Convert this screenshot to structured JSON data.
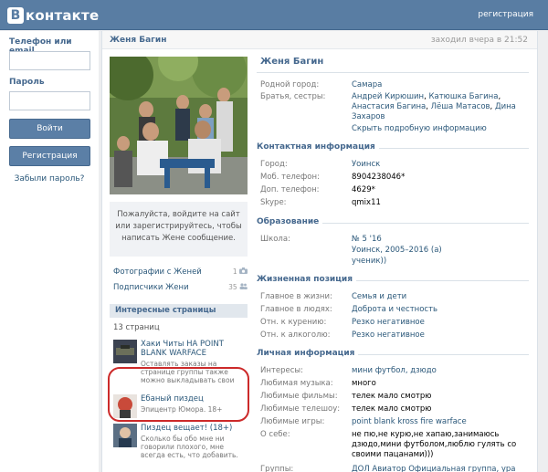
{
  "header": {
    "logo_mark": "В",
    "logo_text": "контакте",
    "register_link": "регистрация"
  },
  "login": {
    "phone_label": "Телефон или email",
    "password_label": "Пароль",
    "login_button": "Войти",
    "register_button": "Регистрация",
    "forgot_link": "Забыли пароль?"
  },
  "profile": {
    "head_name": "Женя Багин",
    "status": "заходил вчера в 21:52",
    "name": "Женя Багин",
    "message_prompt": "Пожалуйста, войдите на сайт или зарегистрируйтесь, чтобы написать Жене сообщение.",
    "photos_link": "Фотографии с Женей",
    "photos_count": "1",
    "subscribers_link": "Подписчики Жени",
    "subscribers_count": "35",
    "interesting_title": "Интересные страницы",
    "pages_count": "13 страниц",
    "pages": [
      {
        "title": "Хаки Читы НА POINT BLANK WARFACE",
        "desc": "Оставлять заказы на странице группы также можно выкладывать свои"
      },
      {
        "title": "Ебаный пиздец",
        "desc": "Эпицентр Юмора. 18+"
      },
      {
        "title": "Пиздец вещает! (18+)",
        "desc": "Сколько бы обо мне ни говорили плохого, мне всегда есть, что добавить."
      }
    ]
  },
  "info": {
    "hometown_label": "Родной город:",
    "hometown": "Самара",
    "siblings_label": "Братья, сестры:",
    "siblings": [
      "Андрей Кирюшин",
      "Катюшка Багина",
      "Анастасия Багина",
      "Лёша Матасов",
      "Дина Захаров"
    ],
    "show_more": "Скрыть подробную информацию",
    "contact_title": "Контактная информация",
    "city_label": "Город:",
    "city": "Уоинск",
    "mobile_label": "Моб. телефон:",
    "mobile": "8904238046*",
    "extra_phone_label": "Доп. телефон:",
    "extra_phone": "4629*",
    "skype_label": "Skype:",
    "skype": "qmix11",
    "education_title": "Образование",
    "school_label": "Школа:",
    "school": "№ 5 '16",
    "school_detail": "Уоинск, 2005–2016 (а)",
    "school_role": "ученик))",
    "position_title": "Жизненная позиция",
    "main_label": "Главное в жизни:",
    "main": "Семья и дети",
    "people_label": "Главное в людях:",
    "people": "Доброта и честность",
    "smoking_label": "Отн. к курению:",
    "smoking": "Резко негативное",
    "alcohol_label": "Отн. к алкоголю:",
    "alcohol": "Резко негативное",
    "personal_title": "Личная информация",
    "interests_label": "Интересы:",
    "interests": "мини футбол, дзюдо",
    "music_label": "Любимая музыка:",
    "music": "много",
    "films_label": "Любимые фильмы:",
    "films": "телек мало смотрю",
    "tv_label": "Любимые телешоу:",
    "tv": "телек мало смотрю",
    "games_label": "Любимые игры:",
    "games": "point blank kross fire warface",
    "about_label": "О себе:",
    "about": "не пю,не курю,не хапаю,занимаюсь дзюдо,мини футболом,люблю гулять со своими пацанами)))",
    "groups_label": "Группы:",
    "groups": "ДОЛ Авиатор Официальная группа, ура"
  }
}
